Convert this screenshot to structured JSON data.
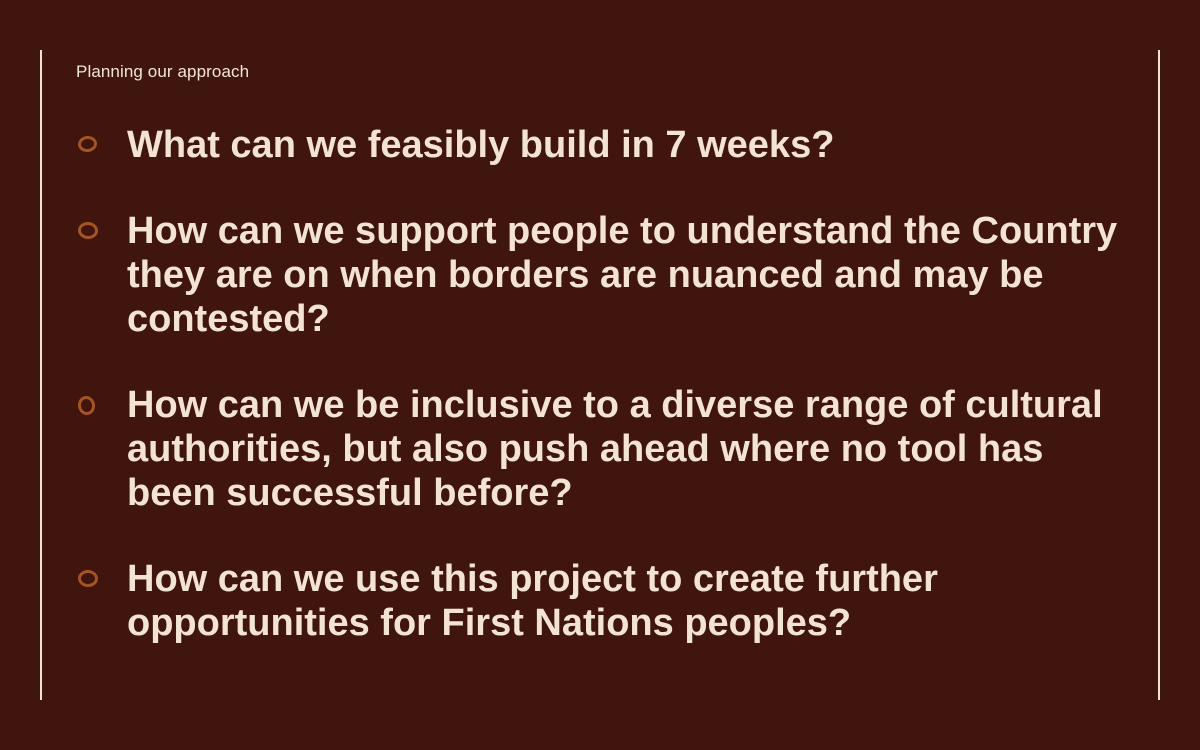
{
  "slide": {
    "eyebrow": "Planning our approach",
    "questions": [
      "What can we feasibly build in 7 weeks?",
      "How can we support people to understand the Country they are on when borders are nuanced and may be contested?",
      "How can we be inclusive to a diverse range of cultural authorities, but also push ahead where no tool has been successful before?",
      "How can we use this project to create further opportunities for First Nations peoples?"
    ],
    "bullet_icon": "hand-drawn-circle-icon"
  },
  "colors": {
    "background": "#3f150e",
    "text": "#f3e3d1",
    "bullet": "#a55423",
    "rule": "#efe3d6"
  }
}
